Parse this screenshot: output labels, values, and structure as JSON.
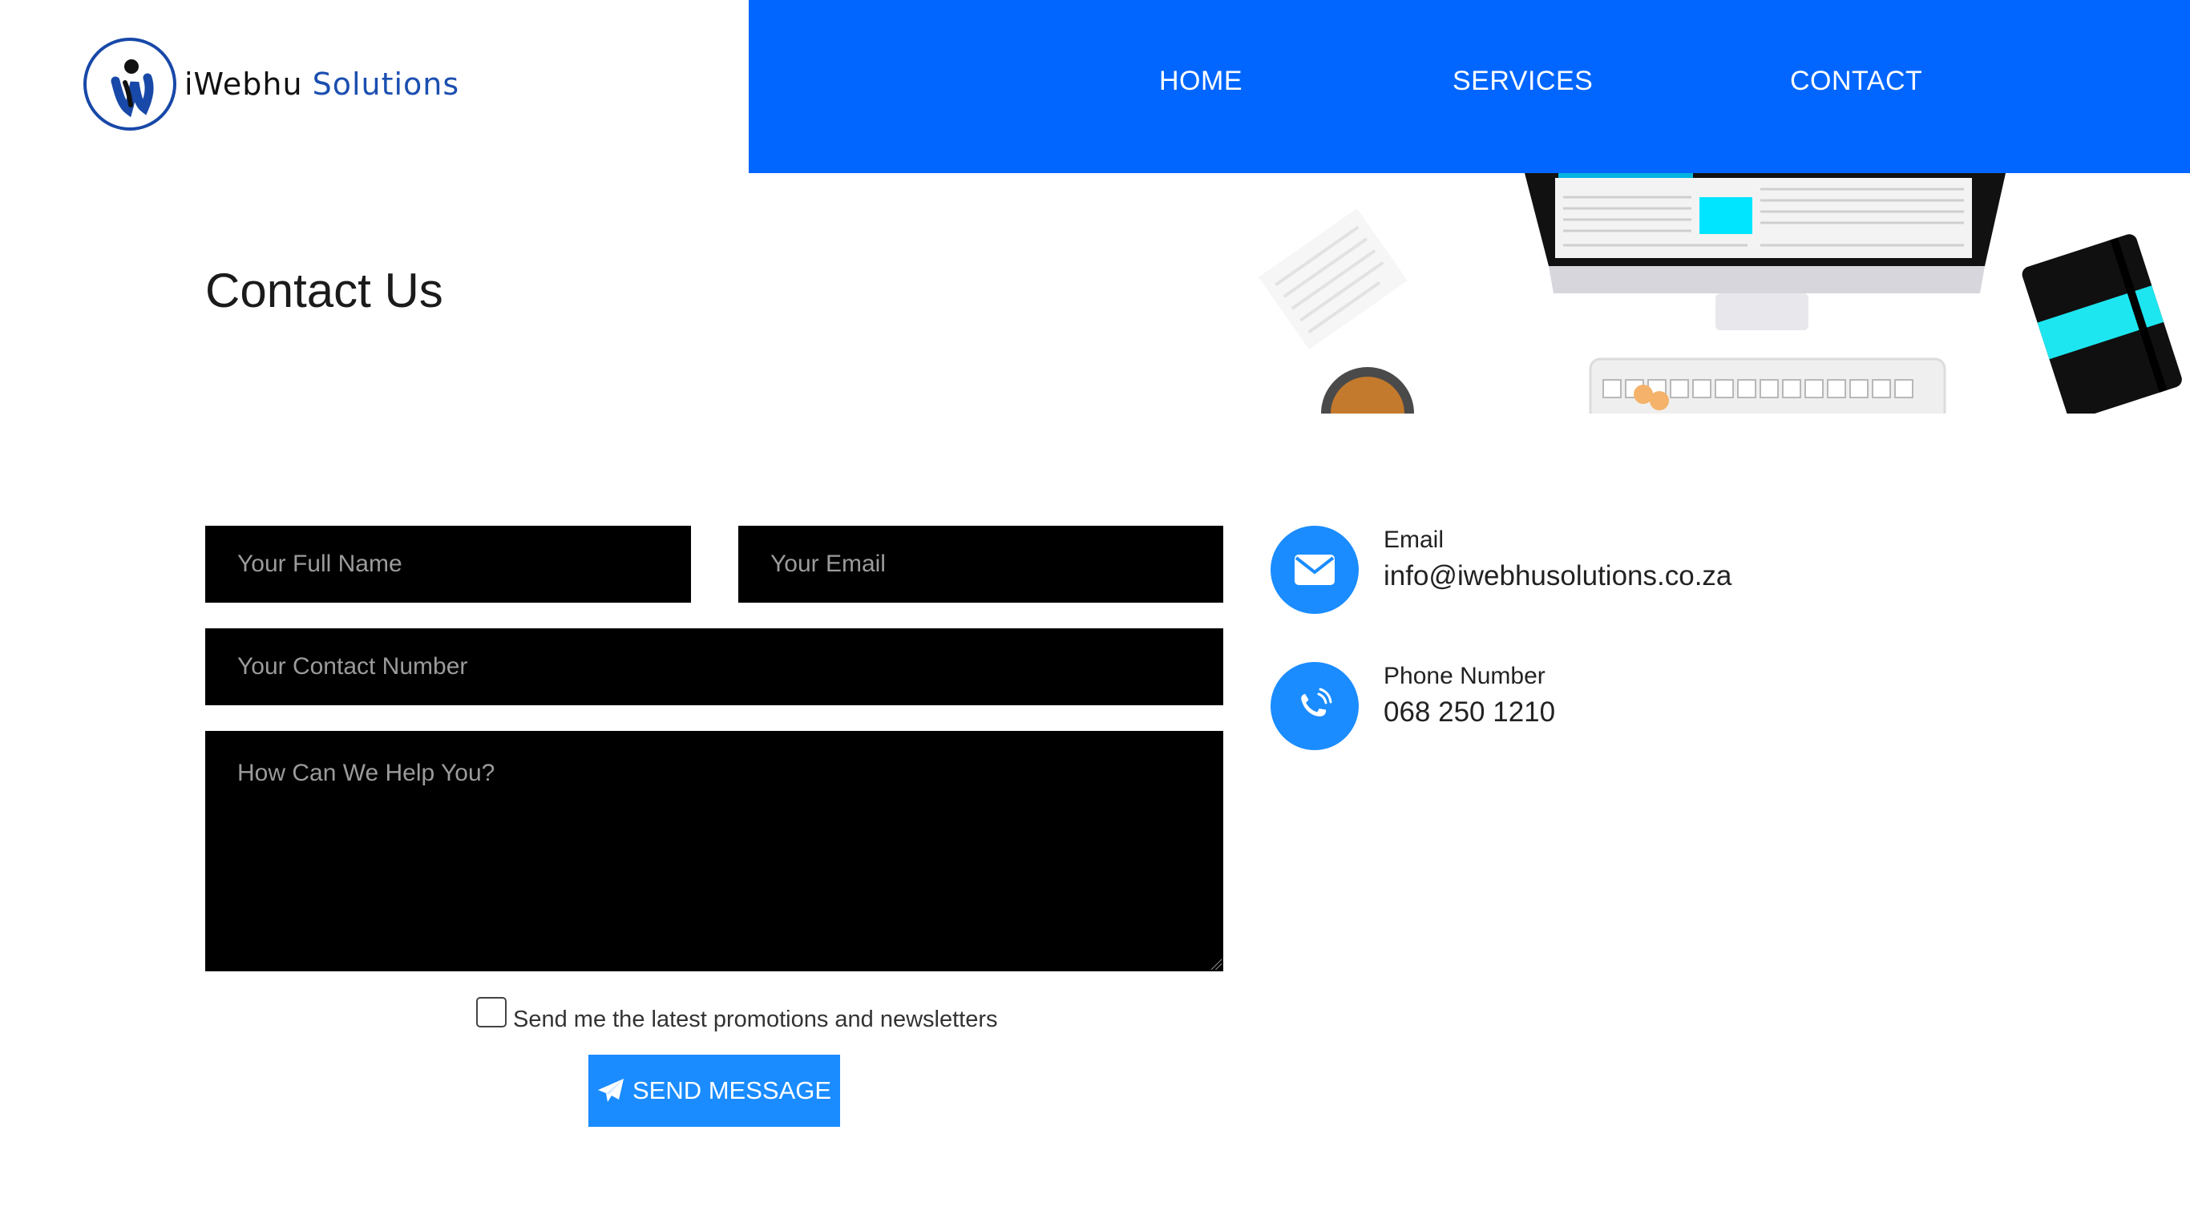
{
  "brand": {
    "name_part1": "iWebhu",
    "name_part2": "Solutions",
    "color_primary": "#0066ff",
    "color_logo": "#1848a8"
  },
  "nav": {
    "items": [
      {
        "label": "HOME"
      },
      {
        "label": "SERVICES"
      },
      {
        "label": "CONTACT"
      }
    ]
  },
  "page": {
    "title": "Contact Us"
  },
  "form": {
    "full_name_placeholder": "Your Full Name",
    "email_placeholder": "Your Email",
    "contact_number_placeholder": "Your Contact Number",
    "message_placeholder": "How Can We Help You?",
    "newsletter_label": "Send me the latest promotions and newsletters",
    "newsletter_checked": false,
    "submit_label": "SEND MESSAGE",
    "submit_icon": "paper-plane-icon",
    "accent_color": "#1a8cff"
  },
  "contact_info": {
    "email": {
      "label": "Email",
      "value": "info@iwebhusolutions.co.za",
      "icon": "envelope-icon"
    },
    "phone": {
      "label": "Phone Number",
      "value": "068 250 1210",
      "icon": "phone-icon"
    }
  }
}
